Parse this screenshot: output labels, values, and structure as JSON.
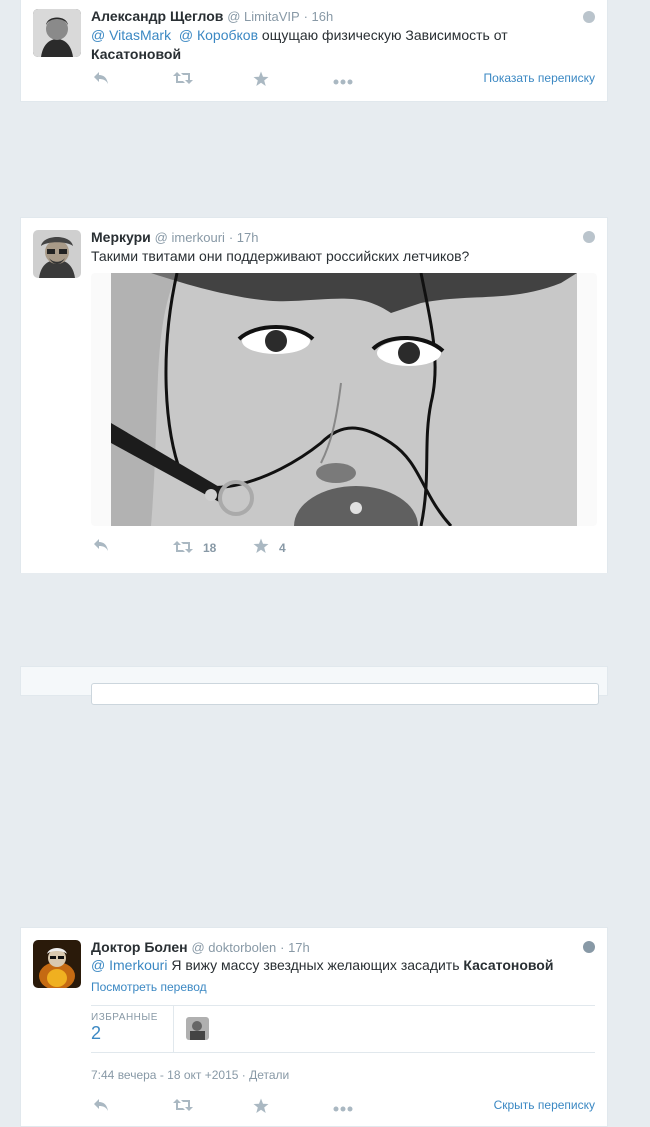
{
  "tweets": [
    {
      "fullname": "Александр Щеглов",
      "handle": "@ LimitaVIP",
      "time": "· 16h",
      "mention1": "@ VitasMark",
      "mention2": "@ Коробков",
      "text": " ощущаю физическую Зависимость от",
      "text_bold": "Касатоновой",
      "conversation_link": "Показать переписку"
    },
    {
      "fullname": "Меркури",
      "handle": "@ imerkouri",
      "time": "· 17h",
      "text": "Такими твитами они поддерживают российских летчиков?",
      "retweets": "18",
      "favorites": "4"
    },
    {
      "fullname": "Доктор Болен",
      "handle": "@ doktorbolen",
      "time": "· 17h",
      "mention1": "@ Imerkouri",
      "text": " Я вижу массу звездных желающих засадить ",
      "text_bold": "Касатоновой",
      "translate_link": "Посмотреть перевод",
      "favorites_label": "ИЗБРАННЫЕ",
      "favorites_count": "2",
      "timestamp": "7:44 вечера - 18 окт +2015",
      "details_link": "· Детали",
      "conversation_link": "Скрыть переписку"
    }
  ],
  "icons": {
    "reply": "reply-icon",
    "retweet": "retweet-icon",
    "favorite": "star-icon",
    "more": "more-icon",
    "globe": "globe-icon"
  },
  "colors": {
    "link": "#3b88c3",
    "muted": "#8899a6",
    "action": "#aab8c2",
    "background": "#e7ecf0"
  }
}
